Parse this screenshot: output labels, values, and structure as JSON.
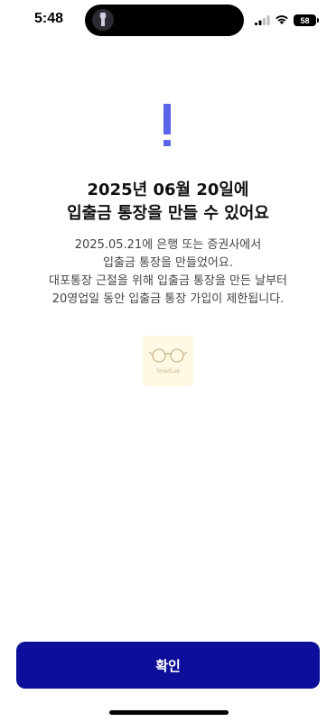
{
  "status_bar": {
    "time": "5:48",
    "battery": "58",
    "icons": [
      "signal-icon",
      "wifi-icon",
      "battery-icon",
      "flashlight-icon"
    ]
  },
  "alert": {
    "icon": "exclamation-icon",
    "accent_color": "#5b63e8",
    "title_line1": "2025년 06월 20일에",
    "title_line2": "입출금 통장을 만들 수 있어요",
    "desc_line1": "2025.05.21에 은행 또는 증권사에서",
    "desc_line2": "입출금 통장을 만들었어요.",
    "desc_line3": "대포통장 근절을 위해 입출금 통장을 만든 날부터",
    "desc_line4": "20영업일 동안 입출금 통장 가입이 제한됩니다."
  },
  "watermark": {
    "text": "SmartLab"
  },
  "footer": {
    "confirm_label": "확인",
    "button_color": "#0d0f9a"
  }
}
